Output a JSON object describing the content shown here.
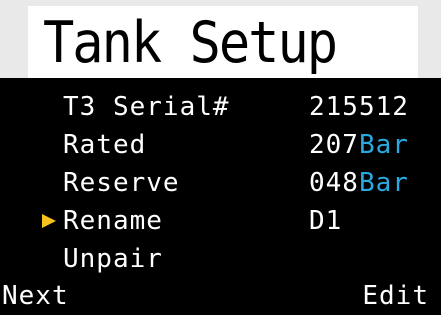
{
  "header": {
    "title": "Tank Setup"
  },
  "menu": {
    "items": [
      {
        "label": "T3 Serial#",
        "value": "215512",
        "unit": ""
      },
      {
        "label": "Rated",
        "value": "207",
        "unit": "Bar"
      },
      {
        "label": "Reserve",
        "value": "048",
        "unit": "Bar"
      },
      {
        "label": "Rename",
        "value": "D1",
        "unit": "",
        "selected": true
      },
      {
        "label": "Unpair",
        "value": "",
        "unit": ""
      }
    ]
  },
  "footer": {
    "left_label": "Next",
    "right_label": "Edit"
  },
  "colors": {
    "background": "#000000",
    "text": "#ffffff",
    "unit_accent": "#29a9e0",
    "cursor": "#f7c21b",
    "title_bg": "#ffffff"
  }
}
